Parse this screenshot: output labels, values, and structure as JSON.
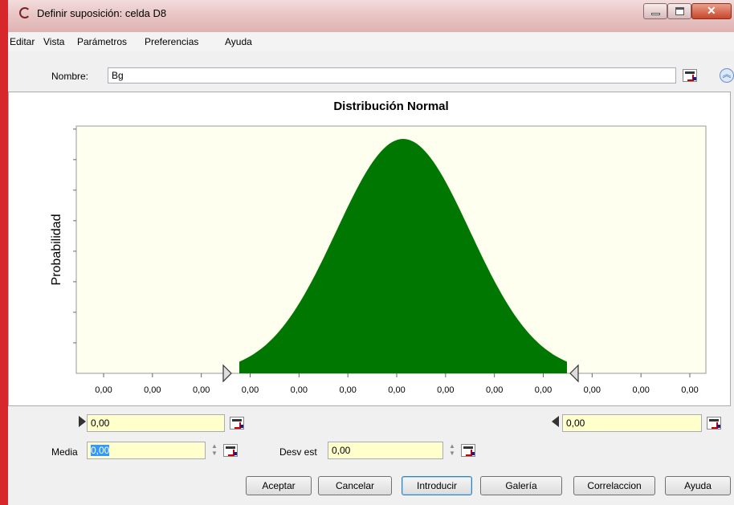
{
  "window": {
    "title": "Definir suposición: celda D8"
  },
  "menu": [
    "Editar",
    "Vista",
    "Parámetros",
    "Preferencias",
    "Ayuda"
  ],
  "name_field": {
    "label": "Nombre:",
    "value": "Bg"
  },
  "chart_data": {
    "type": "area",
    "title": "Distribución Normal",
    "ylabel": "Probabilidad",
    "xlabel": "",
    "x_tick_labels": [
      "0,00",
      "0,00",
      "0,00",
      "0,00",
      "0,00",
      "0,00",
      "0,00",
      "0,00",
      "0,00",
      "0,00",
      "0,00",
      "0,00",
      "0,00"
    ],
    "y_ticks": 8,
    "grid": false,
    "distribution": "normal",
    "shaded_range_std": [
      -2.45,
      2.45
    ],
    "fill_color": "#007700",
    "plot_background": "#fffff0"
  },
  "controls": {
    "lower_bound": "0,00",
    "upper_bound": "0,00",
    "media_label": "Media",
    "media_value": "0,00",
    "desv_label": "Desv est",
    "desv_value": "0,00"
  },
  "buttons": [
    "Aceptar",
    "Cancelar",
    "Introducir",
    "Galería",
    "Correlaccion",
    "Ayuda"
  ],
  "icons": [
    "app-icon",
    "minimize-icon",
    "maximize-icon",
    "close-icon",
    "cell-reference-icon",
    "collapse-icon",
    "left-marker-icon",
    "right-marker-icon"
  ]
}
